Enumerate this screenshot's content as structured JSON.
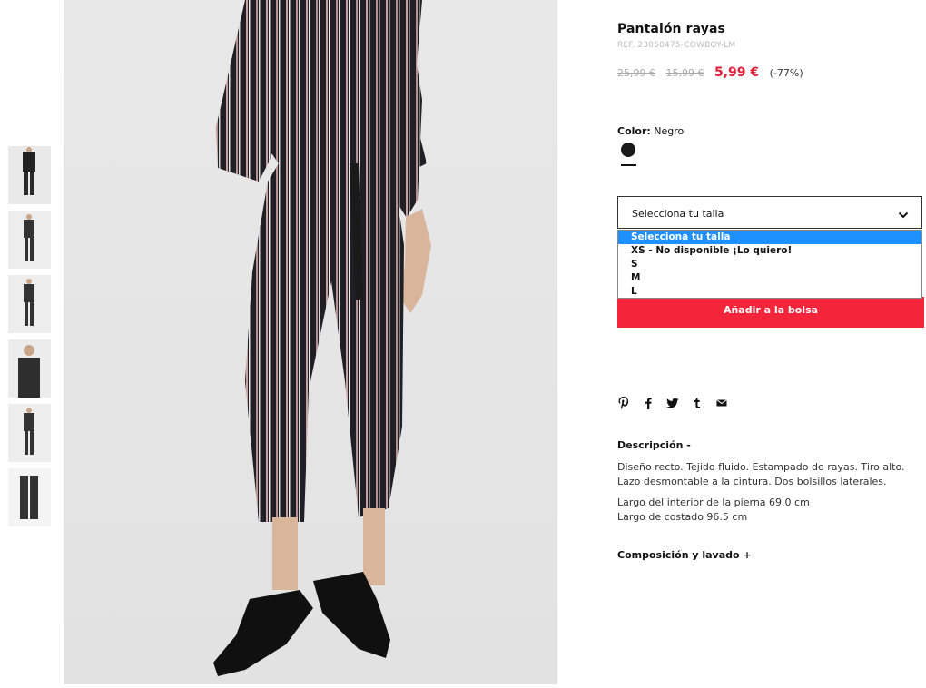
{
  "product": {
    "title": "Pantalón rayas",
    "ref": "REF. 23050475-COWBOY-LM",
    "price_original_1": "25,99 €",
    "price_original_2": "15,99 €",
    "price_sale": "5,99 €",
    "discount": "(-77%)"
  },
  "color": {
    "label": "Color:",
    "value": "Negro",
    "swatch_hex": "#1a1a1a"
  },
  "size_select": {
    "selected": "Selecciona tu talla",
    "options": [
      "Selecciona tu talla",
      "XS - No disponible ¡Lo quiero!",
      "S",
      "M",
      "L"
    ]
  },
  "add_to_bag": "Añadir a la bolsa",
  "share_icons": [
    "pinterest-icon",
    "facebook-icon",
    "twitter-icon",
    "tumblr-icon",
    "email-icon"
  ],
  "description": {
    "title": "Descripción -",
    "paragraph_1": "Diseño recto. Tejido fluido. Estampado de rayas. Tiro alto. Lazo desmontable a la cintura. Dos bolsillos laterales.",
    "line_1": "Largo del interior de la pierna 69.0 cm",
    "line_2": "Largo de costado 96.5 cm"
  },
  "composition_title": "Composición y lavado +",
  "colors": {
    "accent": "#f4243a",
    "sale_price": "#e21e3a",
    "selected_option": "#1e90ff"
  }
}
